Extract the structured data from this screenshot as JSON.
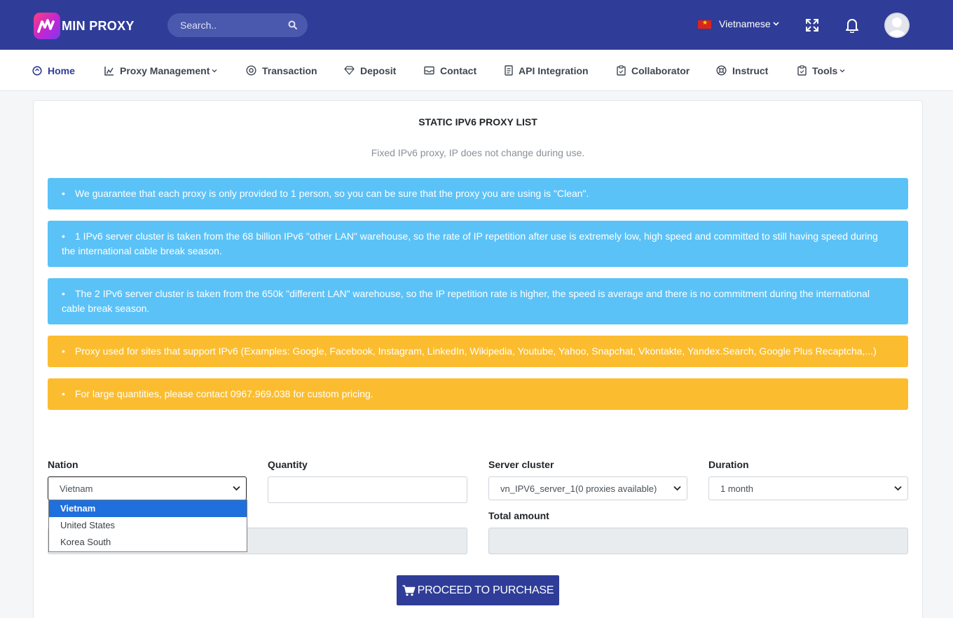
{
  "header": {
    "brand": "MIN PROXY",
    "search_placeholder": "Search..",
    "language": "Vietnamese"
  },
  "nav": {
    "items": [
      {
        "label": "Home",
        "icon": "home-circle-icon"
      },
      {
        "label": "Proxy Management",
        "icon": "chart-icon",
        "has_dropdown": true
      },
      {
        "label": "Transaction",
        "icon": "target-icon"
      },
      {
        "label": "Deposit",
        "icon": "diamond-icon"
      },
      {
        "label": "Contact",
        "icon": "inbox-icon"
      },
      {
        "label": "API Integration",
        "icon": "document-icon"
      },
      {
        "label": "Collaborator",
        "icon": "clipboard-icon"
      },
      {
        "label": "Instruct",
        "icon": "lifebuoy-icon"
      },
      {
        "label": "Tools",
        "icon": "clipboard-icon",
        "has_dropdown": true
      }
    ]
  },
  "page": {
    "title": "STATIC IPV6 PROXY LIST",
    "subtitle": "Fixed IPv6 proxy, IP does not change during use."
  },
  "alerts": [
    {
      "type": "info",
      "text": "We guarantee that each proxy is only provided to 1 person, so you can be sure that the proxy you are using is \"Clean\"."
    },
    {
      "type": "info",
      "text": "1 IPv6 server cluster is taken from the 68 billion IPv6 \"other LAN\" warehouse, so the rate of IP repetition after use is extremely low, high speed and committed to still having speed during the international cable break season."
    },
    {
      "type": "info",
      "text": "The 2 IPv6 server cluster is taken from the 650k \"different LAN\" warehouse, so the IP repetition rate is higher, the speed is average and there is no commitment during the international cable break season."
    },
    {
      "type": "warn",
      "text": "Proxy used for sites that support IPv6 (Examples: Google, Facebook, Instagram, LinkedIn, Wikipedia, Youtube, Yahoo, Snapchat, Vkontakte, Yandex.Search, Google Plus Recaptcha,...)"
    },
    {
      "type": "warn",
      "text": "For large quantities, please contact 0967.969.038 for custom pricing."
    }
  ],
  "form": {
    "nation": {
      "label": "Nation",
      "value": "Vietnam",
      "options": [
        "Vietnam",
        "United States",
        "Korea South"
      ],
      "selected_index": 0
    },
    "quantity": {
      "label": "Quantity",
      "value": ""
    },
    "server_cluster": {
      "label": "Server cluster",
      "value": "vn_IPV6_server_1(0 proxies available)"
    },
    "duration": {
      "label": "Duration",
      "value": "1 month"
    },
    "total_amount": {
      "label": "Total amount",
      "value": ""
    },
    "submit_label": "PROCEED TO PURCHASE"
  },
  "colors": {
    "primary": "#2f3d98",
    "info": "#5bc2f7",
    "warning": "#fbbd2f",
    "selected_option": "#1f6fdc"
  }
}
